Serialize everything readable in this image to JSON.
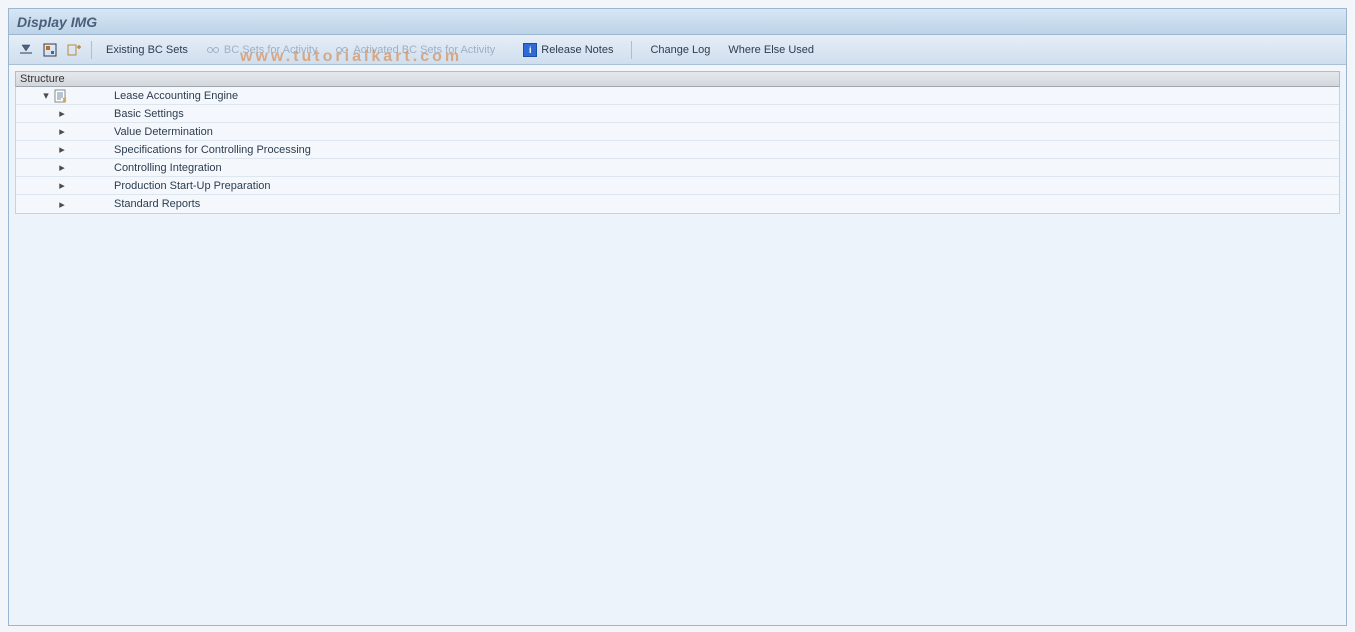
{
  "title": "Display IMG",
  "watermark": "www.tutorialkart.com",
  "toolbar": {
    "existing_bc_sets": "Existing BC Sets",
    "bc_sets_for_activity": "BC Sets for Activity",
    "activated_bc_sets_for_activity": "Activated BC Sets for Activity",
    "release_notes": "Release Notes",
    "change_log": "Change Log",
    "where_else_used": "Where Else Used"
  },
  "structure_header": "Structure",
  "tree": {
    "root": "Lease Accounting Engine",
    "children": [
      "Basic Settings",
      "Value Determination",
      "Specifications for Controlling Processing",
      "Controlling Integration",
      "Production Start-Up Preparation",
      "Standard Reports"
    ]
  }
}
